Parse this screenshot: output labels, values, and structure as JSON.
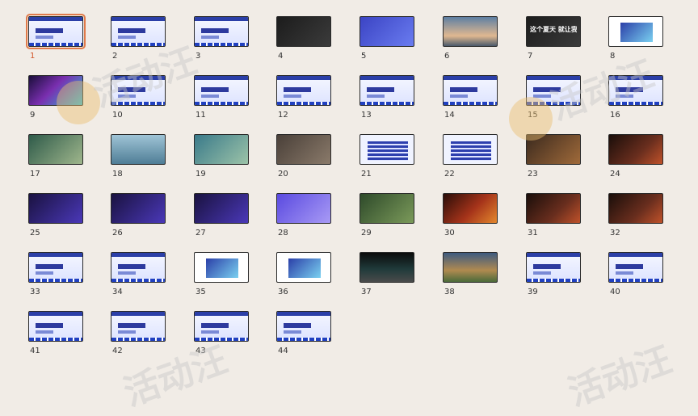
{
  "slides": [
    {
      "number": "1",
      "style": "t-light",
      "caption": "",
      "selected": true
    },
    {
      "number": "2",
      "style": "t-light",
      "caption": ""
    },
    {
      "number": "3",
      "style": "t-light",
      "caption": ""
    },
    {
      "number": "4",
      "style": "t-dark",
      "caption": ""
    },
    {
      "number": "5",
      "style": "t-blue",
      "caption": ""
    },
    {
      "number": "6",
      "style": "t-sky",
      "caption": ""
    },
    {
      "number": "7",
      "style": "t-dark",
      "caption": "这个夏天 就让我们"
    },
    {
      "number": "8",
      "style": "t-white",
      "caption": ""
    },
    {
      "number": "9",
      "style": "t-party",
      "caption": ""
    },
    {
      "number": "10",
      "style": "t-light",
      "caption": ""
    },
    {
      "number": "11",
      "style": "t-light",
      "caption": ""
    },
    {
      "number": "12",
      "style": "t-light",
      "caption": ""
    },
    {
      "number": "13",
      "style": "t-light",
      "caption": ""
    },
    {
      "number": "14",
      "style": "t-light",
      "caption": ""
    },
    {
      "number": "15",
      "style": "t-light",
      "caption": ""
    },
    {
      "number": "16",
      "style": "t-light",
      "caption": ""
    },
    {
      "number": "17",
      "style": "t-forest",
      "caption": ""
    },
    {
      "number": "18",
      "style": "t-lake",
      "caption": ""
    },
    {
      "number": "19",
      "style": "t-valley",
      "caption": ""
    },
    {
      "number": "20",
      "style": "t-stone",
      "caption": ""
    },
    {
      "number": "21",
      "style": "t-table",
      "caption": ""
    },
    {
      "number": "22",
      "style": "t-table",
      "caption": ""
    },
    {
      "number": "23",
      "style": "t-crowd",
      "caption": ""
    },
    {
      "number": "24",
      "style": "t-night",
      "caption": ""
    },
    {
      "number": "25",
      "style": "t-stage",
      "caption": ""
    },
    {
      "number": "26",
      "style": "t-stage",
      "caption": ""
    },
    {
      "number": "27",
      "style": "t-stage",
      "caption": ""
    },
    {
      "number": "28",
      "style": "t-purple",
      "caption": ""
    },
    {
      "number": "29",
      "style": "t-green",
      "caption": ""
    },
    {
      "number": "30",
      "style": "t-fire",
      "caption": ""
    },
    {
      "number": "31",
      "style": "t-night",
      "caption": ""
    },
    {
      "number": "32",
      "style": "t-night",
      "caption": ""
    },
    {
      "number": "33",
      "style": "t-light",
      "caption": ""
    },
    {
      "number": "34",
      "style": "t-light",
      "caption": ""
    },
    {
      "number": "35",
      "style": "t-white",
      "caption": ""
    },
    {
      "number": "36",
      "style": "t-white",
      "caption": ""
    },
    {
      "number": "37",
      "style": "t-blackstage",
      "caption": ""
    },
    {
      "number": "38",
      "style": "t-cabin",
      "caption": ""
    },
    {
      "number": "39",
      "style": "t-light",
      "caption": ""
    },
    {
      "number": "40",
      "style": "t-light",
      "caption": ""
    },
    {
      "number": "41",
      "style": "t-light",
      "caption": ""
    },
    {
      "number": "42",
      "style": "t-light",
      "caption": ""
    },
    {
      "number": "43",
      "style": "t-light",
      "caption": ""
    },
    {
      "number": "44",
      "style": "t-light",
      "caption": ""
    }
  ],
  "colors": {
    "background": "#f1ece6",
    "selection": "#e07a4a",
    "accent": "#2b3fa8"
  },
  "watermark": {
    "text": "活动汪"
  }
}
